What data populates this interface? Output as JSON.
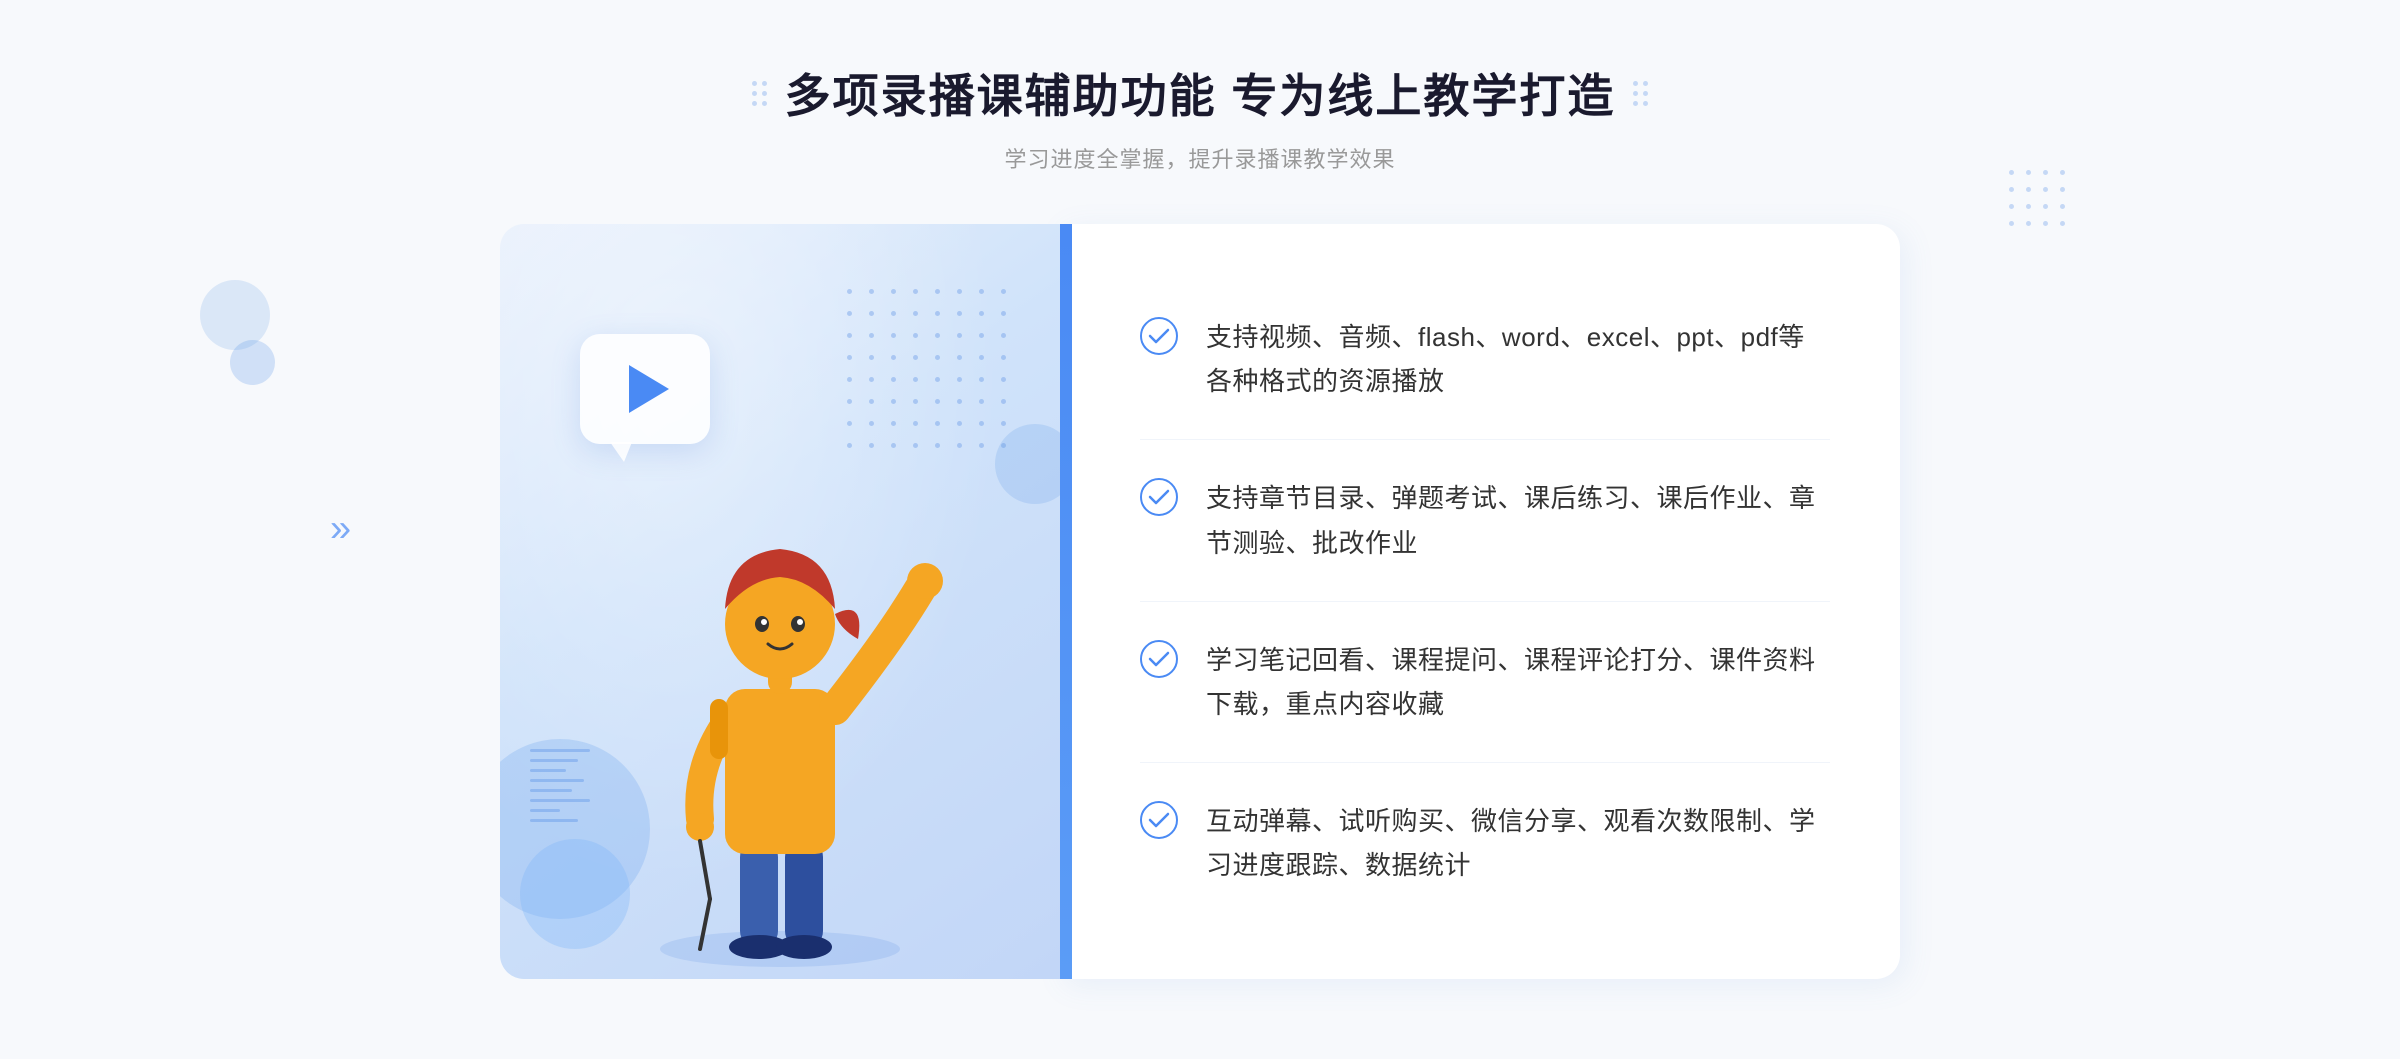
{
  "header": {
    "title": "多项录播课辅助功能 专为线上教学打造",
    "subtitle": "学习进度全掌握，提升录播课教学效果"
  },
  "features": [
    {
      "id": "feature-1",
      "text": "支持视频、音频、flash、word、excel、ppt、pdf等各种格式的资源播放"
    },
    {
      "id": "feature-2",
      "text": "支持章节目录、弹题考试、课后练习、课后作业、章节测验、批改作业"
    },
    {
      "id": "feature-3",
      "text": "学习笔记回看、课程提问、课程评论打分、课件资料下载，重点内容收藏"
    },
    {
      "id": "feature-4",
      "text": "互动弹幕、试听购买、微信分享、观看次数限制、学习进度跟踪、数据统计"
    }
  ],
  "colors": {
    "accent_blue": "#4a8af4",
    "light_blue": "#5b9cf6",
    "text_dark": "#1a1a2e",
    "text_gray": "#999999",
    "text_body": "#333333"
  },
  "icons": {
    "check": "✓",
    "play": "▶",
    "chevron": "»"
  }
}
